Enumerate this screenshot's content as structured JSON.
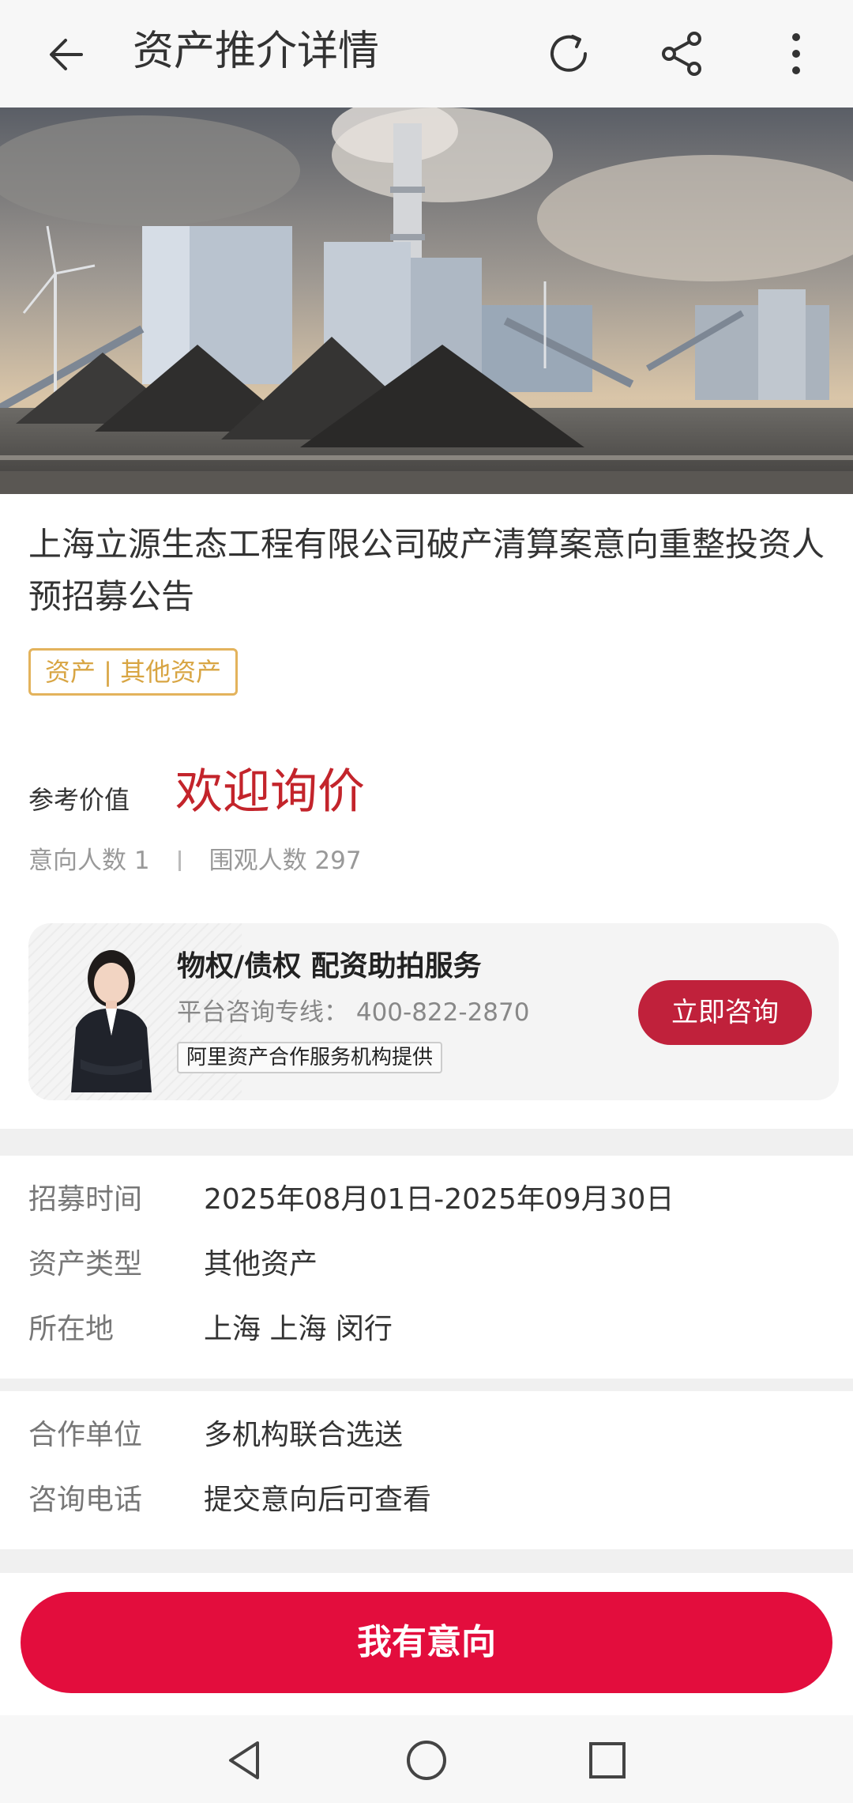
{
  "header": {
    "title": "资产推介详情",
    "back_icon": "arrow-left-icon",
    "refresh_icon": "refresh-icon",
    "share_icon": "share-icon",
    "more_icon": "more-vertical-icon"
  },
  "hero": {
    "image": "power-plant-photo"
  },
  "asset": {
    "title": "上海立源生态工程有限公司破产清算案意向重整投资人预招募公告",
    "tag": "资产 | 其他资产",
    "ref_label": "参考价值",
    "ref_value": "欢迎询价",
    "intent_count": "意向人数 1",
    "view_count": "围观人数 297"
  },
  "service": {
    "title": "物权/债权  配资助拍服务",
    "phone": "平台咨询专线： 400-822-2870",
    "provider": "阿里资产合作服务机构提供",
    "button": "立即咨询"
  },
  "info1": [
    {
      "label": "招募时间",
      "value": "2025年08月01日-2025年09月30日"
    },
    {
      "label": "资产类型",
      "value": "其他资产"
    },
    {
      "label": "所在地",
      "value": "上海 上海 闵行"
    }
  ],
  "info2": [
    {
      "label": "合作单位",
      "value": "多机构联合选送"
    },
    {
      "label": "咨询电话",
      "value": "提交意向后可查看"
    }
  ],
  "bottom": {
    "intent_button": "我有意向"
  },
  "colors": {
    "accent": "#e30d3d",
    "price": "#c3242b",
    "tag": "#d8a543",
    "consult": "#c0213b"
  }
}
